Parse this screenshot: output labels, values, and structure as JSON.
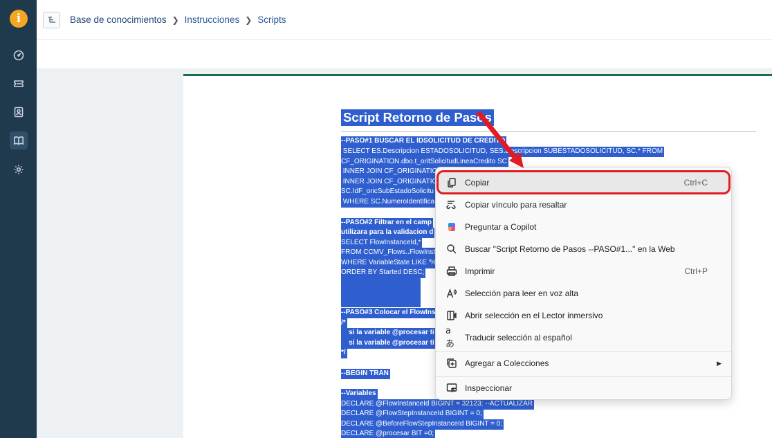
{
  "app": {
    "logo_letter": "i",
    "accent_color": "#f5a623",
    "sidebar_color": "#1f3a4d",
    "nav_icons": [
      "gauge-icon",
      "ticket-icon",
      "contact-icon",
      "book-icon",
      "gear-icon"
    ]
  },
  "breadcrumb": {
    "items": [
      "Base de conocimientos",
      "Instrucciones",
      "Scripts"
    ]
  },
  "doc": {
    "title": "Script Retorno de Pasos",
    "lines": [
      "--PASO#1 BUSCAR EL IDSOLICITUD DE CREDITO",
      " SELECT ES.Descripcion ESTADOSOLICITUD, SES.Descripcion SUBESTADOSOLICITUD, SC.* FROM",
      "CF_ORIGINATION.dbo.t_oritSolicitudLineaCredito SC",
      " INNER JOIN CF_ORIGINATION",
      " INNER JOIN CF_ORIGINATION",
      "SC.IdF_oricSubEstadoSolicitu",
      " WHERE SC.NumeroIdentifica",
      "--PASO#2 Filtrar en el camp",
      "utilizara para la validacion d",
      "SELECT FlowInstanceId,*",
      "FROM CCMV_Flows..FlowInsta",
      "WHERE VariableState LIKE '%2",
      "ORDER BY Started DESC;",
      "--PASO#3 Colocar el FlowIns",
      "/*",
      "    si la variable @procesar ti",
      "    si la variable @procesar ti",
      "*/",
      "--BEGIN TRAN",
      "--Variables",
      "DECLARE @FlowInstanceId BIGINT = 32123; --ACTUALIZAR",
      "DECLARE @FlowStepInstanceId BIGINT = 0;",
      "DECLARE @BeforeFlowStepInstanceId BIGINT = 0;",
      "DECLARE @procesar BIT =0;"
    ]
  },
  "context_menu": {
    "copy": {
      "label": "Copiar",
      "shortcut": "Ctrl+C"
    },
    "copy_link": {
      "label": "Copiar vínculo para resaltar"
    },
    "copilot": {
      "label": "Preguntar a Copilot"
    },
    "search_web": {
      "label": "Buscar \"Script Retorno de Pasos --PASO#1...\" en la Web"
    },
    "print": {
      "label": "Imprimir",
      "shortcut": "Ctrl+P"
    },
    "read_aloud": {
      "label": "Selección para leer en voz alta"
    },
    "immersive_reader": {
      "label": "Abrir selección en el Lector inmersivo"
    },
    "translate": {
      "label": "Traducir selección al español"
    },
    "collections": {
      "label": "Agregar a Colecciones"
    },
    "inspect": {
      "label": "Inspeccionar"
    }
  }
}
